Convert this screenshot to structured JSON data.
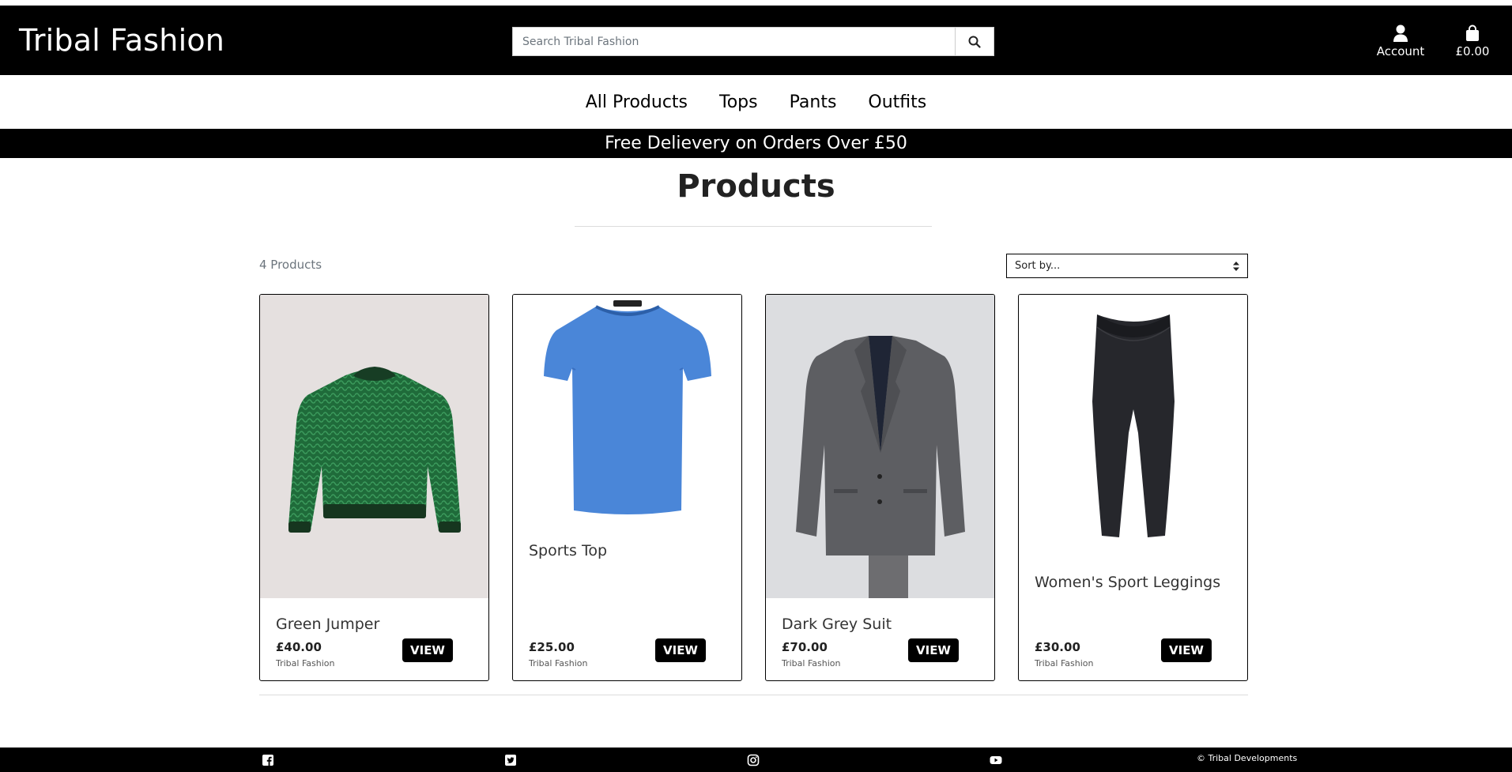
{
  "header": {
    "logo": "Tribal Fashion",
    "search_placeholder": "Search Tribal Fashion",
    "account_label": "Account",
    "bag_total": "£0.00"
  },
  "nav": {
    "items": [
      {
        "label": "All Products"
      },
      {
        "label": "Tops"
      },
      {
        "label": "Pants"
      },
      {
        "label": "Outfits"
      }
    ]
  },
  "banner": "Free Delievery on Orders Over £50",
  "main": {
    "title": "Products",
    "count": "4 Products",
    "sort_label": "Sort by..."
  },
  "products": [
    {
      "name": "Green Jumper",
      "price": "£40.00",
      "brand": "Tribal Fashion",
      "button": "VIEW"
    },
    {
      "name": "Sports Top",
      "price": "£25.00",
      "brand": "Tribal Fashion",
      "button": "VIEW"
    },
    {
      "name": "Dark Grey Suit",
      "price": "£70.00",
      "brand": "Tribal Fashion",
      "button": "VIEW"
    },
    {
      "name": "Women's Sport Leggings",
      "price": "£30.00",
      "brand": "Tribal Fashion",
      "button": "VIEW"
    }
  ],
  "footer": {
    "icons": [
      "facebook-icon",
      "twitter-icon",
      "instagram-icon",
      "youtube-icon"
    ],
    "copyright": "© Tribal Developments"
  },
  "colors": {
    "brand_black": "#000000",
    "background": "#ffffff",
    "muted_text": "#6c757d"
  }
}
